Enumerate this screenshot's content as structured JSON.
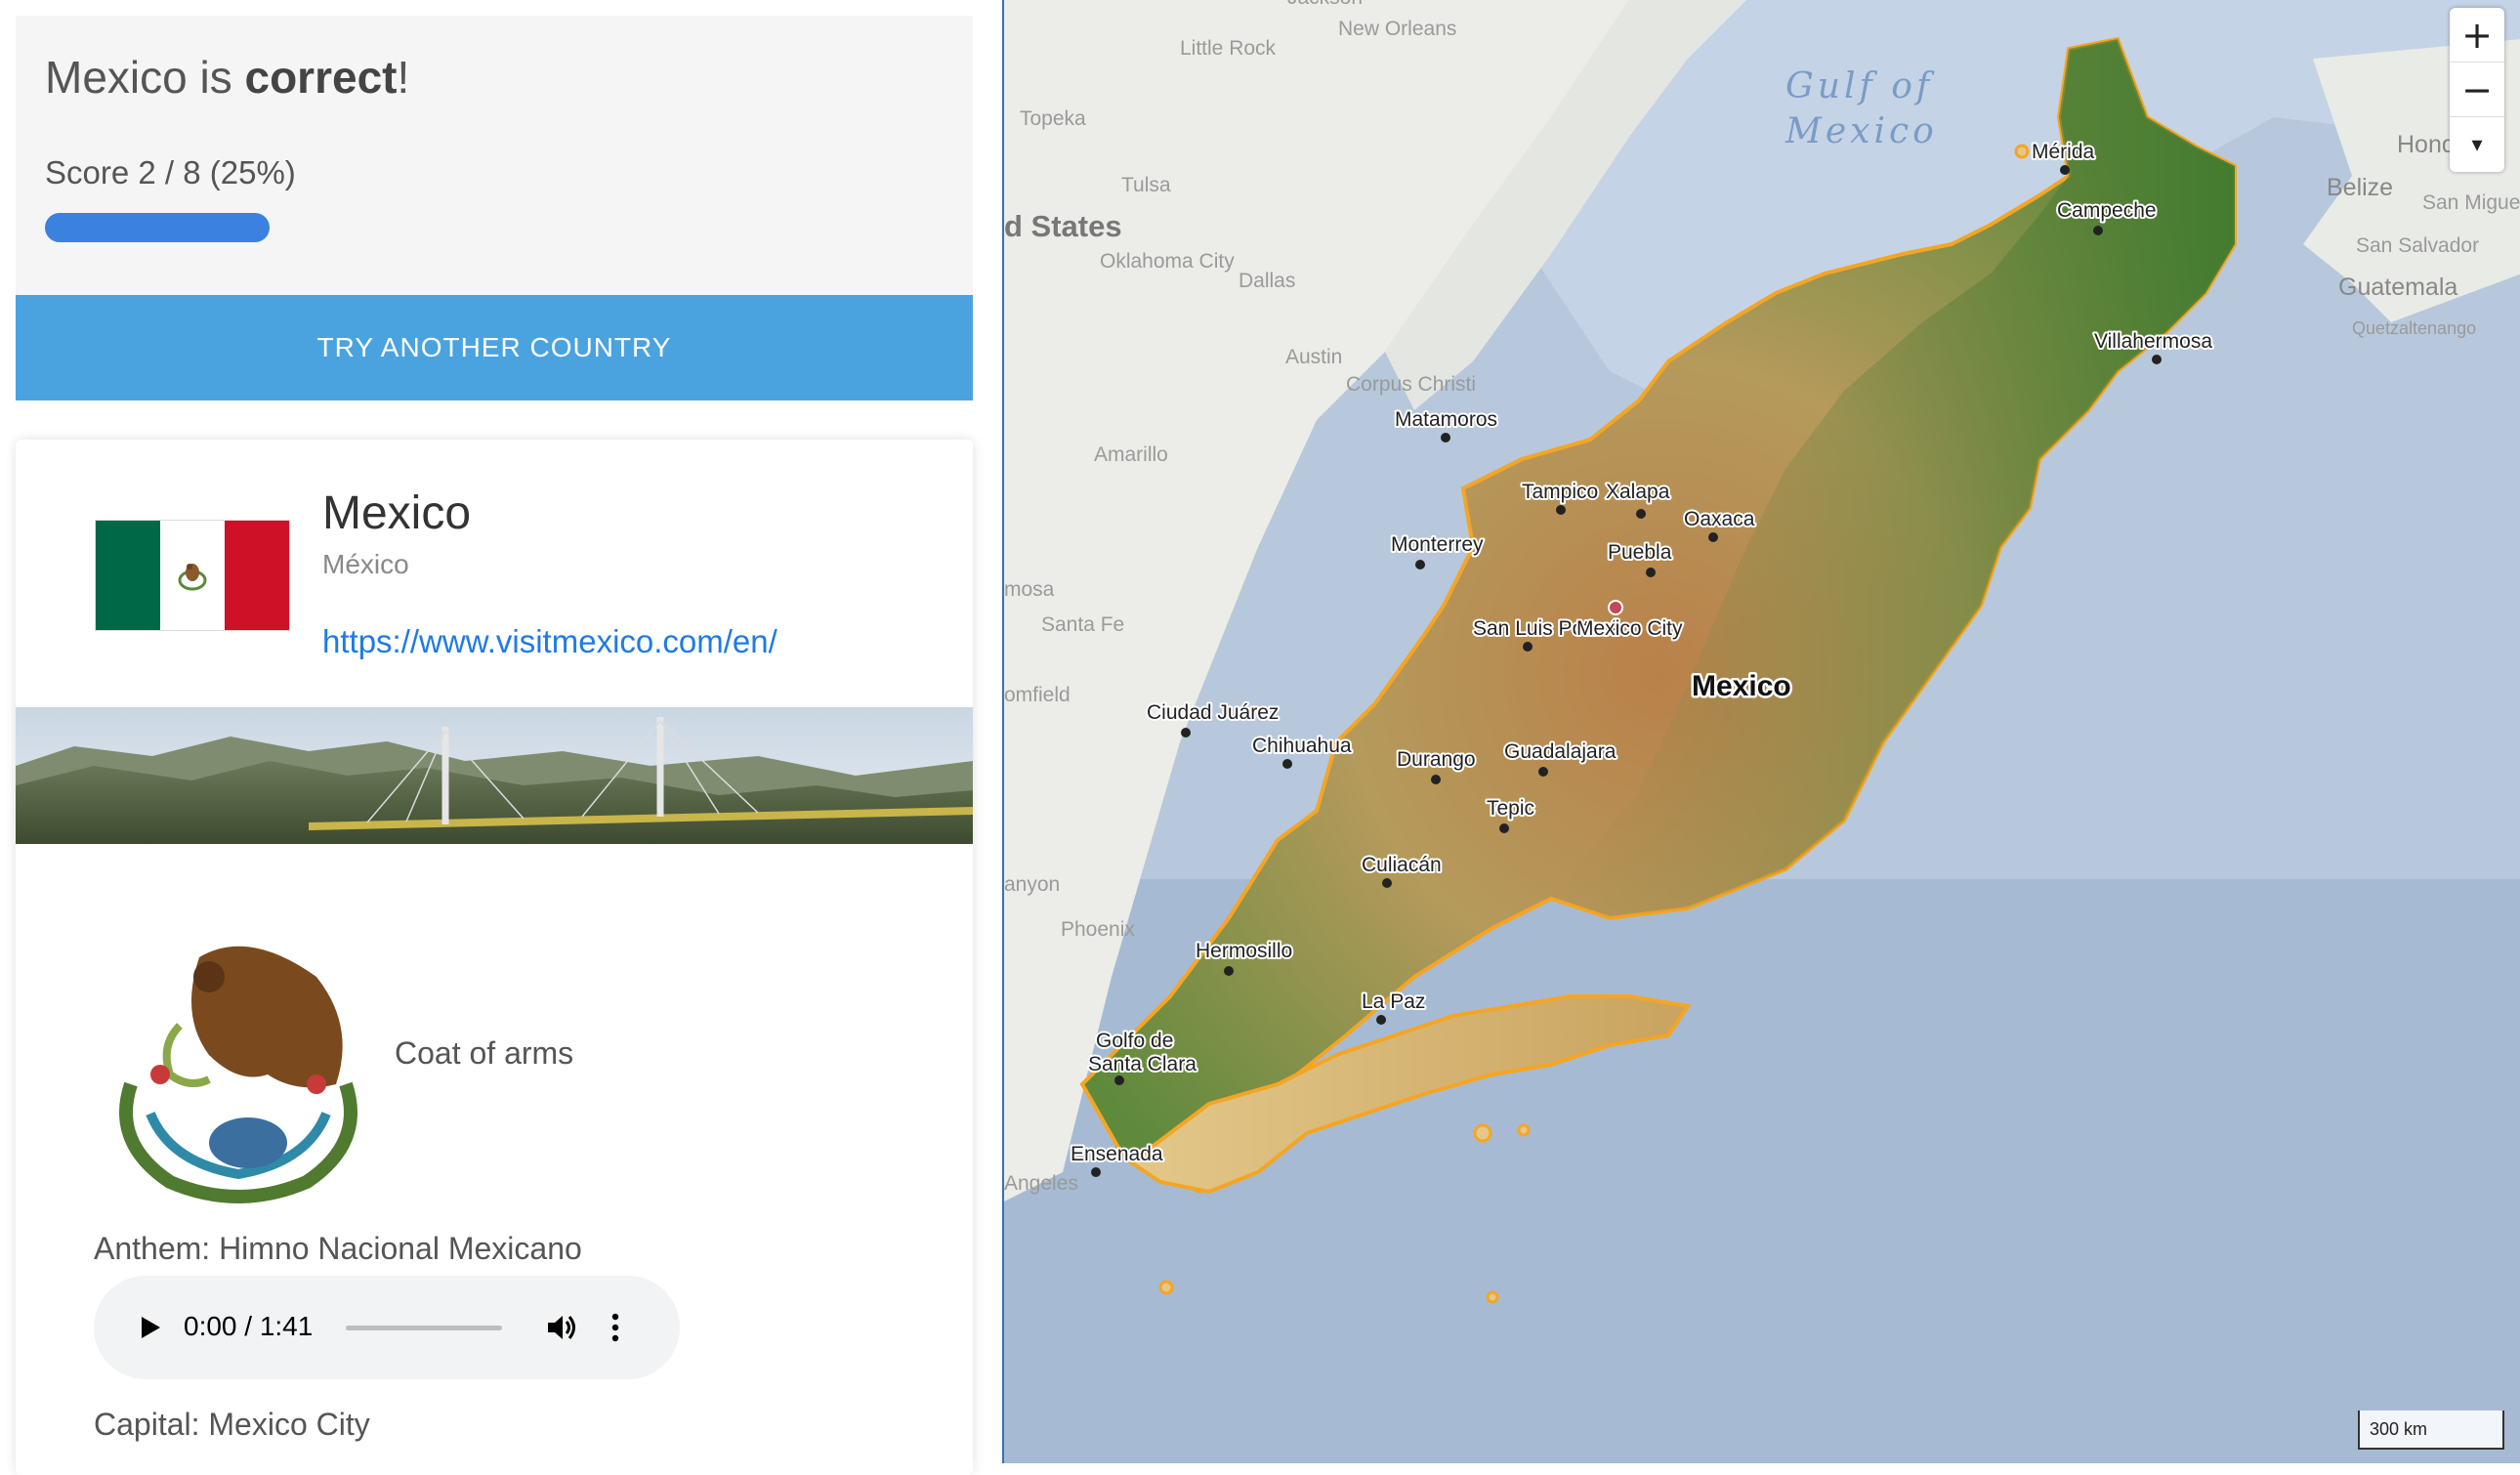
{
  "result": {
    "country": "Mexico",
    "mid": " is ",
    "verdict": "correct",
    "end": "!"
  },
  "score": {
    "label": "Score 2 / 8 (25%)",
    "progress_fraction": 0.25,
    "bar_color": "#3b82e0"
  },
  "try_button": {
    "label": "TRY ANOTHER COUNTRY",
    "color": "#4aa3df"
  },
  "country": {
    "name": "Mexico",
    "native_name": "México",
    "link": "https://www.visitmexico.com/en/",
    "flag_colors": [
      "#006847",
      "#ffffff",
      "#ce1126"
    ],
    "coat_of_arms_label": "Coat of arms",
    "anthem_label": "Anthem: Himno Nacional Mexicano",
    "capital_label": "Capital: Mexico City"
  },
  "audio": {
    "time": "0:00 / 1:41",
    "icons": [
      "play-icon",
      "volume-icon",
      "more-vertical-icon"
    ]
  },
  "map": {
    "zoom_in": "+",
    "zoom_out": "−",
    "compass": "▾",
    "scale": "300 km",
    "highlight_color": "#f5a524",
    "sea_label_1": "Gulf of",
    "sea_label_2": "Mexico",
    "country_label": "Mexico",
    "region_labels": [
      "d States",
      "Honduras",
      "Belize",
      "Guatemala",
      "San Salvador",
      "San Miguel",
      "Quetzaltenango"
    ],
    "cities": [
      "Mérida",
      "Campeche",
      "Villahermosa",
      "Matamoros",
      "Tampico",
      "Xalapa",
      "Oaxaca",
      "Puebla",
      "Monterrey",
      "San Luis Potosí",
      "Mexico City",
      "Ciudad Juárez",
      "Chihuahua",
      "Durango",
      "Guadalajara",
      "Tepic",
      "Culiacán",
      "Hermosillo",
      "La Paz",
      "Golfo de",
      "Santa Clara",
      "Ensenada"
    ],
    "faint_cities": [
      "New Orleans",
      "Little Rock",
      "Topeka",
      "Tulsa",
      "Oklahoma City",
      "Dallas",
      "Austin",
      "Corpus Christi",
      "Amarillo",
      "Santa Fe",
      "Phoenix",
      "mosa",
      "omfield",
      "anyon",
      "Angeles",
      "Jackson"
    ]
  }
}
